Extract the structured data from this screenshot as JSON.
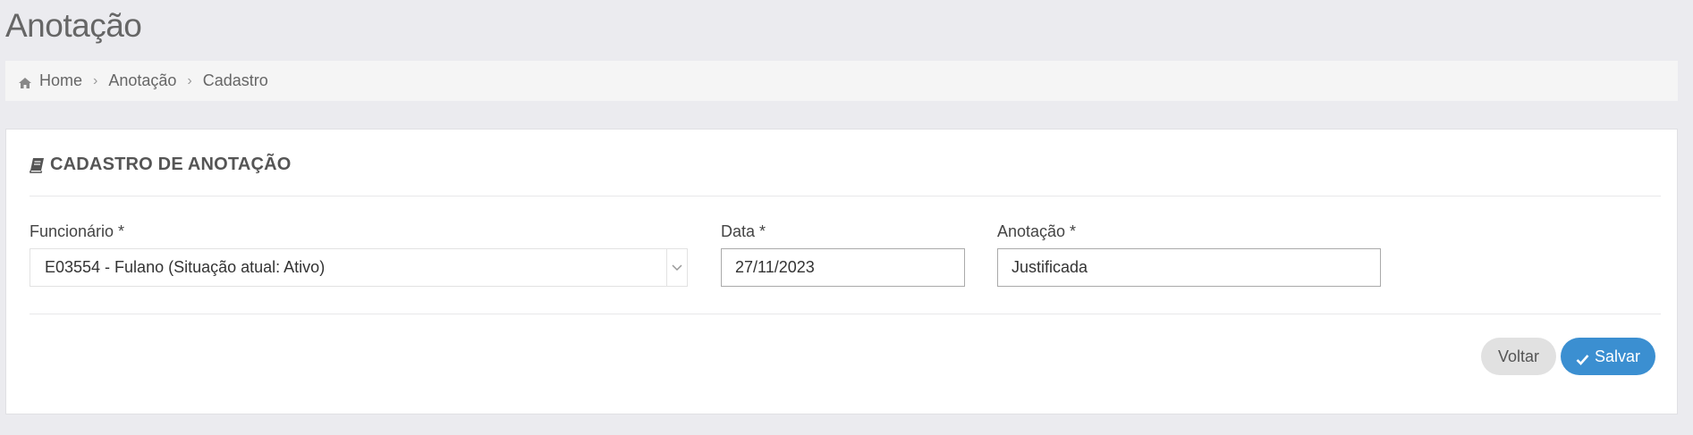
{
  "page": {
    "title": "Anotação"
  },
  "breadcrumb": {
    "items": [
      "Home",
      "Anotação",
      "Cadastro"
    ]
  },
  "card": {
    "title": "CADASTRO DE ANOTAÇÃO"
  },
  "form": {
    "funcionario": {
      "label": "Funcionário *",
      "value": "E03554 - Fulano (Situação atual: Ativo)"
    },
    "data": {
      "label": "Data *",
      "value": "27/11/2023"
    },
    "anotacao": {
      "label": "Anotação *",
      "value": "Justificada"
    }
  },
  "actions": {
    "back_label": "Voltar",
    "save_label": "Salvar"
  },
  "colors": {
    "primary": "#3b8fd1",
    "background": "#ebebef"
  },
  "icons": {
    "home": "home-icon",
    "book": "book-icon",
    "select": "chevron-down-icon",
    "save": "check-icon"
  }
}
